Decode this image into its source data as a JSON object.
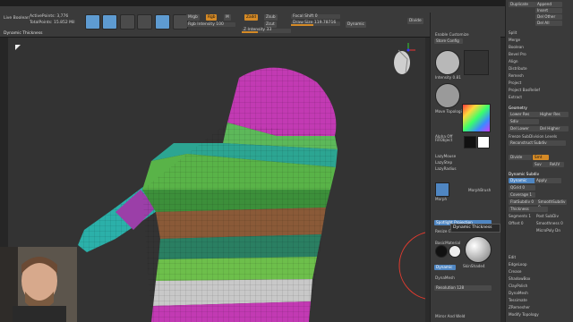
{
  "menubar": {
    "items": [
      "Alpha",
      "Brush",
      "Color",
      "Document",
      "Draw",
      "Dynamics",
      "Edit",
      "File",
      "IMM.ZBR",
      "Layer",
      "Light",
      "Macro",
      "Marker",
      "Material",
      "Movie",
      "Picker",
      "Preferences",
      "Popup",
      "Prev",
      "Render",
      "Stencil",
      "Stroke",
      "Texture",
      "Tool",
      "Transform",
      "Zplugin",
      "Z_Zeech",
      "Help"
    ]
  },
  "toolbar": {
    "live_boolean": "Live Boolean",
    "active_points": "ActivePoints: 3,776",
    "total_points": "TotalPoints: 15.852 Mil",
    "mrgb": "Mrgb",
    "rgb": "Rgb",
    "m": "M",
    "zadd": "Zadd",
    "zsub": "Zsub",
    "zcut": "Zcut",
    "rgb_intensity": "Rgb Intensity 100",
    "z_intensity": "Z Intensity 33",
    "focal_shift": "Focal Shift 0",
    "draw_size": "Draw Size 119.78716",
    "dynamic": "Dynamic",
    "divide": "Divide",
    "brush_title": "Dynamic Thickness"
  },
  "right_panel": {
    "enable_customize": "Enable Customize",
    "store_config": "Store Config",
    "brush_label": "Intensity 0.81",
    "move_topo": "Move Topological",
    "alpha_off": "Alpha Off",
    "fill_object": "FillObject",
    "lazy_mouse": "LazyMouse",
    "lazy_step": "LazyStep",
    "lazy_radius": "LazyRadius",
    "morph": "Morph",
    "morph_brush": "MorphBrush",
    "spotlight": "Spotlight Projection",
    "resize_curve": "Resize Curve",
    "basic_material": "BasicMaterial",
    "skin_shade": "SkinShade4",
    "dynamic_btn": "Dynamic",
    "dyna_mesh": "DynaMesh",
    "resolution": "Resolution 128",
    "mirror_weld": "Mirror And Weld"
  },
  "tooltip": {
    "text": "Dynamic Thickness"
  },
  "tray2": {
    "items": [
      "Duplicate",
      "Append",
      "Insert",
      "Del Other",
      "Del All",
      "Split",
      "Merge",
      "Boolean",
      "Bevel Pro",
      "Align",
      "Distribute",
      "Remesh",
      "Project",
      "Project BasRelief",
      "Extract",
      "Geometry",
      "Lower Res",
      "Higher Res",
      "Sdiv",
      "Del Lower",
      "Del Higher",
      "Freeze SubDivision Levels",
      "Reconstruct Subdiv",
      "Divide",
      "Smt",
      "Suv",
      "ReUV",
      "Dynamic Subdiv",
      "Dynamic",
      "Apply",
      "QGrid 0",
      "Coverage 1",
      "FlatSubdiv 0",
      "SmoothSubdiv 0",
      "Thickness",
      "Segments 1",
      "Post SubDiv",
      "Offset 0",
      "Smoothness 0",
      "MicroPoly Dn",
      "Edit",
      "EdgeLoop",
      "Crease",
      "ShadowBox",
      "ClayPolish",
      "DynaMesh",
      "Tessimate",
      "ZRemesher",
      "Modify Topology"
    ]
  },
  "colors": {
    "accent_orange": "#d58a26",
    "accent_blue": "#4f86c2",
    "panel_bg": "#3a3a3a",
    "viewport_bg": "#333333"
  }
}
